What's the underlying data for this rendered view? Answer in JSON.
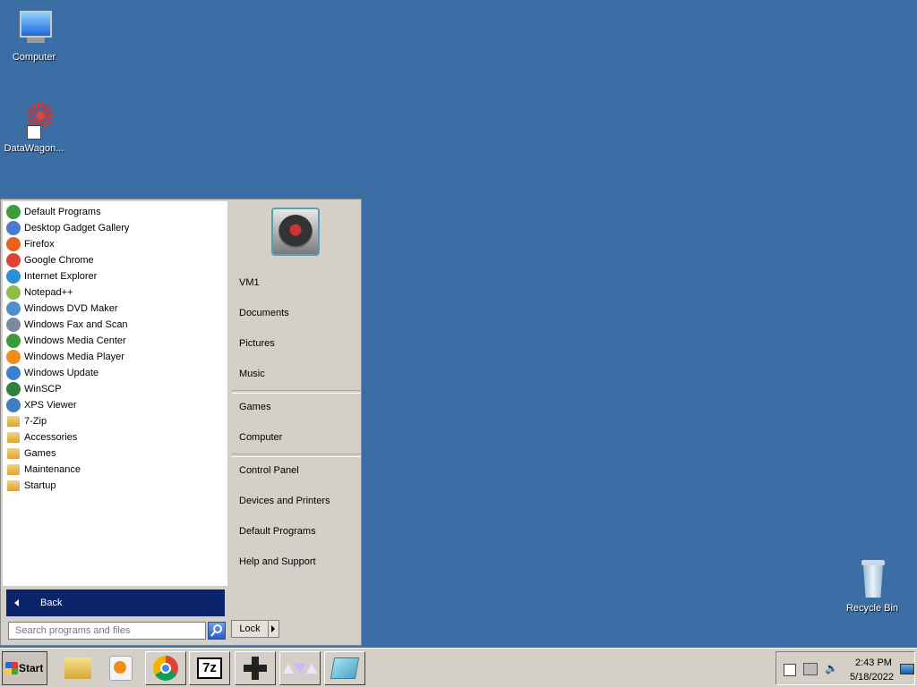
{
  "desktop": {
    "icons": [
      {
        "label": "Computer"
      },
      {
        "label": "DataWagon..."
      },
      {
        "label": "Recycle Bin"
      }
    ]
  },
  "start_menu": {
    "programs": [
      {
        "label": "Default Programs",
        "color": "#3d9a3d"
      },
      {
        "label": "Desktop Gadget Gallery",
        "color": "#4a7bd0"
      },
      {
        "label": "Firefox",
        "color": "#e8611e"
      },
      {
        "label": "Google Chrome",
        "color": "#db4437"
      },
      {
        "label": "Internet Explorer",
        "color": "#2a8fd8"
      },
      {
        "label": "Notepad++",
        "color": "#8bbf4a"
      },
      {
        "label": "Windows DVD Maker",
        "color": "#4f8fcf"
      },
      {
        "label": "Windows Fax and Scan",
        "color": "#7a8aa0"
      },
      {
        "label": "Windows Media Center",
        "color": "#3a9a3a"
      },
      {
        "label": "Windows Media Player",
        "color": "#f08c1c"
      },
      {
        "label": "Windows Update",
        "color": "#3b7fd0"
      },
      {
        "label": "WinSCP",
        "color": "#2f7f3f"
      },
      {
        "label": "XPS Viewer",
        "color": "#3f7fbf"
      }
    ],
    "folders": [
      {
        "label": "7-Zip"
      },
      {
        "label": "Accessories"
      },
      {
        "label": "Games"
      },
      {
        "label": "Maintenance"
      },
      {
        "label": "Startup"
      }
    ],
    "back_label": "Back",
    "search_placeholder": "Search programs and files",
    "right_items": {
      "user": "VM1",
      "documents": "Documents",
      "pictures": "Pictures",
      "music": "Music",
      "games": "Games",
      "computer": "Computer",
      "control_panel": "Control Panel",
      "devices": "Devices and Printers",
      "default_programs": "Default Programs",
      "help": "Help and Support"
    },
    "lock_label": "Lock"
  },
  "taskbar": {
    "start_label": "Start",
    "clock_time": "2:43 PM",
    "clock_date": "5/18/2022",
    "pinned": [
      "explorer-icon",
      "media-player-icon",
      "chrome-icon",
      "7zip-icon",
      "gamepad-icon",
      "triangles-icon",
      "notepad-icon"
    ]
  }
}
